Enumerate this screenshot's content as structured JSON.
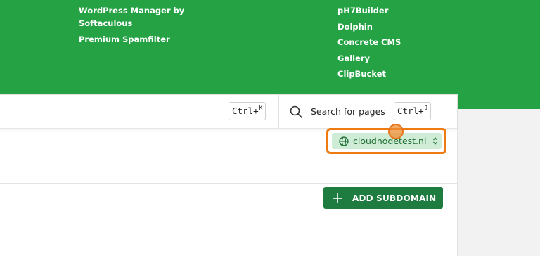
{
  "menu": {
    "left": [
      "WordPress Manager by Softaculous",
      "Premium Spamfilter"
    ],
    "right": [
      "pH7Builder",
      "Dolphin",
      "Concrete CMS",
      "Gallery",
      "ClipBucket"
    ]
  },
  "topbar": {
    "shortcut_left": {
      "key": "Ctrl+",
      "sup": "K"
    },
    "search_label": "Search for pages",
    "shortcut_right": {
      "key": "Ctrl+",
      "sup": "J"
    }
  },
  "domain_selector": {
    "selected": "cloudnodetest.nl",
    "icon": "globe-icon",
    "highlight_color": "#ee7a12"
  },
  "actions": {
    "add_subdomain_label": "ADD SUBDOMAIN",
    "icon": "plus-icon"
  },
  "colors": {
    "brand_green": "#25a244",
    "button_green": "#1e7c40",
    "select_bg": "#cfedd6"
  }
}
